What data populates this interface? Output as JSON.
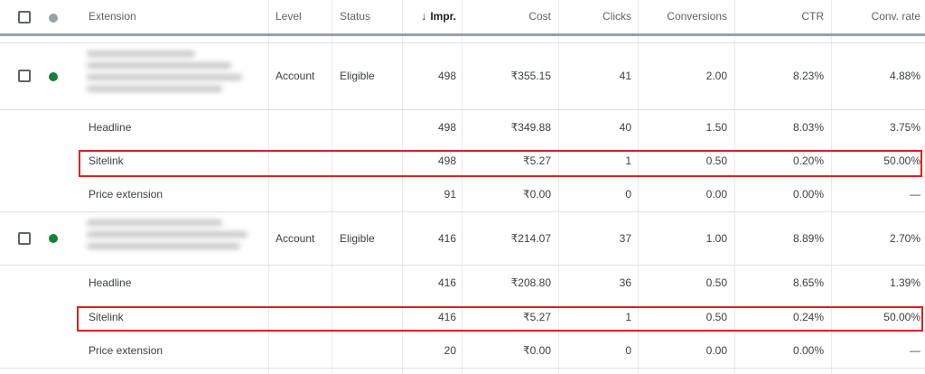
{
  "header": {
    "extension": "Extension",
    "level": "Level",
    "status": "Status",
    "impr_arrow": "↓",
    "impr": "Impr.",
    "cost": "Cost",
    "clicks": "Clicks",
    "conversions": "Conversions",
    "ctr": "CTR",
    "conv_rate": "Conv. rate"
  },
  "colors": {
    "status_dot": "#188038",
    "header_dot": "#9aa0a6",
    "highlight": "#e02020"
  },
  "groups": [
    {
      "main": {
        "level": "Account",
        "status": "Eligible",
        "impr": "498",
        "cost": "₹355.15",
        "clicks": "41",
        "conversions": "2.00",
        "ctr": "8.23%",
        "conv_rate": "4.88%"
      },
      "headline": {
        "name": "Headline",
        "impr": "498",
        "cost": "₹349.88",
        "clicks": "40",
        "conversions": "1.50",
        "ctr": "8.03%",
        "conv_rate": "3.75%"
      },
      "sitelink": {
        "name": "Sitelink",
        "impr": "498",
        "cost": "₹5.27",
        "clicks": "1",
        "conversions": "0.50",
        "ctr": "0.20%",
        "conv_rate": "50.00%"
      },
      "price": {
        "name": "Price extension",
        "impr": "91",
        "cost": "₹0.00",
        "clicks": "0",
        "conversions": "0.00",
        "ctr": "0.00%",
        "conv_rate": "—"
      }
    },
    {
      "main": {
        "level": "Account",
        "status": "Eligible",
        "impr": "416",
        "cost": "₹214.07",
        "clicks": "37",
        "conversions": "1.00",
        "ctr": "8.89%",
        "conv_rate": "2.70%"
      },
      "headline": {
        "name": "Headline",
        "impr": "416",
        "cost": "₹208.80",
        "clicks": "36",
        "conversions": "0.50",
        "ctr": "8.65%",
        "conv_rate": "1.39%"
      },
      "sitelink": {
        "name": "Sitelink",
        "impr": "416",
        "cost": "₹5.27",
        "clicks": "1",
        "conversions": "0.50",
        "ctr": "0.24%",
        "conv_rate": "50.00%"
      },
      "price": {
        "name": "Price extension",
        "impr": "20",
        "cost": "₹0.00",
        "clicks": "0",
        "conversions": "0.00",
        "ctr": "0.00%",
        "conv_rate": "—"
      }
    }
  ]
}
